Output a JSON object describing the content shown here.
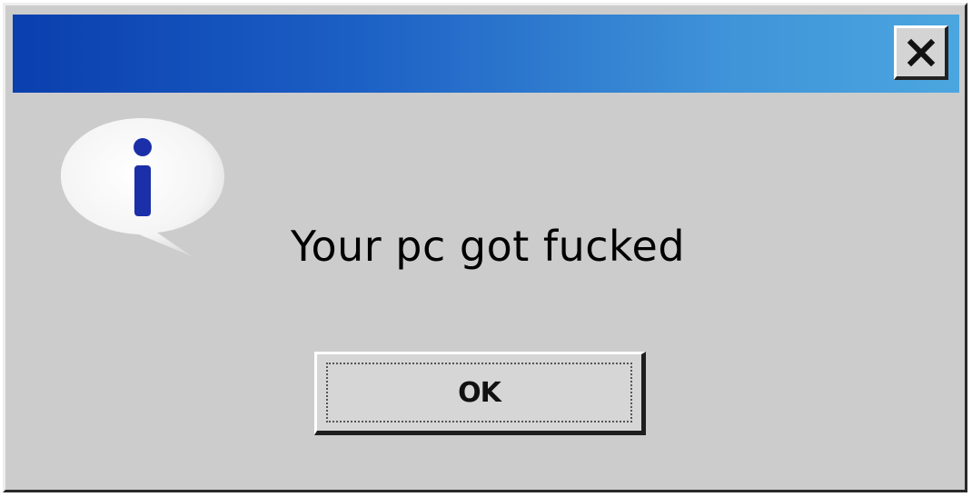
{
  "dialog": {
    "message": "Your pc got fucked",
    "ok_label": "OK",
    "icon": "information-icon",
    "close_icon": "close-icon"
  },
  "colors": {
    "titlebar_start": "#0a3fae",
    "titlebar_end": "#4ba6df",
    "dialog_background": "#cccccc",
    "info_glyph": "#1a2fa8"
  }
}
